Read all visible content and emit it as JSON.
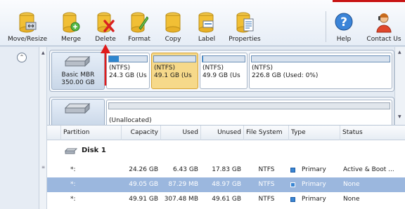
{
  "toolbar": {
    "buttons": [
      {
        "label": "Move/Resize",
        "icon": "move-resize-icon"
      },
      {
        "label": "Merge",
        "icon": "merge-icon"
      },
      {
        "label": "Delete",
        "icon": "delete-icon"
      },
      {
        "label": "Format",
        "icon": "format-icon"
      },
      {
        "label": "Copy",
        "icon": "copy-icon"
      },
      {
        "label": "Label",
        "icon": "label-icon"
      },
      {
        "label": "Properties",
        "icon": "properties-icon"
      },
      {
        "label": "Help",
        "icon": "help-icon"
      },
      {
        "label": "Contact Us",
        "icon": "contact-us-icon"
      }
    ]
  },
  "sidebar": {
    "collapse_glyph": "⌃"
  },
  "disk_map": {
    "disk1": {
      "type": "Basic MBR",
      "size": "350.00 GB",
      "partitions": [
        {
          "fs": "(NTFS)",
          "detail": "24.3 GB (Us",
          "usage": 0.26
        },
        {
          "fs": "(NTFS)",
          "detail": "49.1 GB (Us",
          "usage": 0.0
        },
        {
          "fs": "(NTFS)",
          "detail": "49.9 GB (Us",
          "usage": 0.01
        },
        {
          "fs": "(NTFS)",
          "detail": "226.8 GB (Used: 0%)",
          "usage": 0.0
        }
      ]
    },
    "disk2": {
      "partitions": [
        {
          "fs": "(Unallocated)",
          "detail": ""
        }
      ]
    }
  },
  "partition_list": {
    "headers": [
      "Partition",
      "Capacity",
      "Used",
      "Unused",
      "File System",
      "Type",
      "Status"
    ],
    "disk_label": "Disk 1",
    "rows": [
      {
        "partition": "*:",
        "capacity": "24.26 GB",
        "used": "6.43 GB",
        "unused": "17.83 GB",
        "fs": "NTFS",
        "type": "Primary",
        "status": "Active & Boot ..."
      },
      {
        "partition": "*:",
        "capacity": "49.05 GB",
        "used": "87.29 MB",
        "unused": "48.97 GB",
        "fs": "NTFS",
        "type": "Primary",
        "status": "None"
      },
      {
        "partition": "*:",
        "capacity": "49.91 GB",
        "used": "307.48 MB",
        "unused": "49.61 GB",
        "fs": "NTFS",
        "type": "Primary",
        "status": "None"
      }
    ]
  },
  "colors": {
    "accent": "#2e86cf",
    "selected_row": "#9bb7de",
    "selected_partition": "#f6d98a",
    "annotation_red": "#e01b1b"
  }
}
